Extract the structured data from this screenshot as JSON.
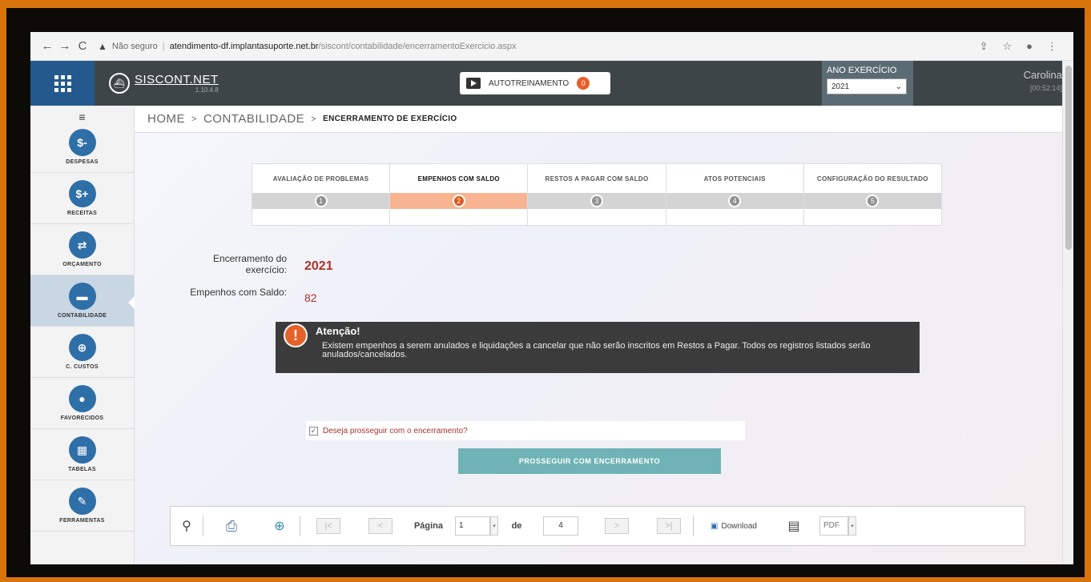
{
  "browser": {
    "back": "←",
    "forward": "→",
    "reload": "C",
    "security_label": "Não seguro",
    "url_host": "atendimento-df.implantasuporte.net.br",
    "url_path": "/siscont/contabilidade/encerramentoExercicio.aspx"
  },
  "header": {
    "brand": "SISCONT.NET",
    "version": "1.10.4.8",
    "autotreinamento": "AUTOTREINAMENTO",
    "autotreinamento_badge": "0",
    "ano_label": "ANO EXERCÍCIO",
    "ano_value": "2021",
    "user_name": "Carolina",
    "user_time": "[00:52:14]"
  },
  "sidebar": {
    "items": [
      {
        "label": "DESPESAS",
        "icon": "$-"
      },
      {
        "label": "RECEITAS",
        "icon": "$+"
      },
      {
        "label": "ORÇAMENTO",
        "icon": "⇄"
      },
      {
        "label": "CONTABILIDADE",
        "icon": "▬"
      },
      {
        "label": "C. CUSTOS",
        "icon": "⊕"
      },
      {
        "label": "FAVORECIDOS",
        "icon": "●"
      },
      {
        "label": "TABELAS",
        "icon": "▦"
      },
      {
        "label": "FERRAMENTAS",
        "icon": "✎"
      }
    ]
  },
  "breadcrumb": {
    "home": "HOME",
    "section": "CONTABILIDADE",
    "current": "ENCERRAMENTO DE EXERCÍCIO"
  },
  "steps": [
    {
      "title": "AVALIAÇÃO DE PROBLEMAS",
      "num": "1"
    },
    {
      "title": "EMPENHOS COM SALDO",
      "num": "2"
    },
    {
      "title": "RESTOS A PAGAR COM SALDO",
      "num": "3"
    },
    {
      "title": "ATOS POTENCIAIS",
      "num": "4"
    },
    {
      "title": "CONFIGURAÇÃO DO RESULTADO",
      "num": "5"
    }
  ],
  "info": {
    "encerramento_label_1": "Encerramento do",
    "encerramento_label_2": "exercício:",
    "encerramento_value": "2021",
    "empenhos_label": "Empenhos com Saldo:",
    "empenhos_value": "82"
  },
  "alert": {
    "icon": "!",
    "title": "Atenção!",
    "text": "Existem empenhos a serem anulados e liquidações a cancelar que não serão inscritos em Restos a Pagar. Todos os registros listados serão anulados/cancelados."
  },
  "confirm": {
    "checked_mark": "✓",
    "label": "Deseja prosseguir com o encerramento?"
  },
  "proceed_button": "PROSSEGUIR COM ENCERRAMENTO",
  "toolbar": {
    "page_label": "Página",
    "page_value": "1",
    "of_label": "de",
    "total_pages": "4",
    "download_label": "Download",
    "format_value": "PDF"
  },
  "colors": {
    "active_step": "#f8b491",
    "alert_bg": "#3b3b3b",
    "proceed_button": "#6fb3b6",
    "sidebar_icon": "#2f6fa8"
  }
}
